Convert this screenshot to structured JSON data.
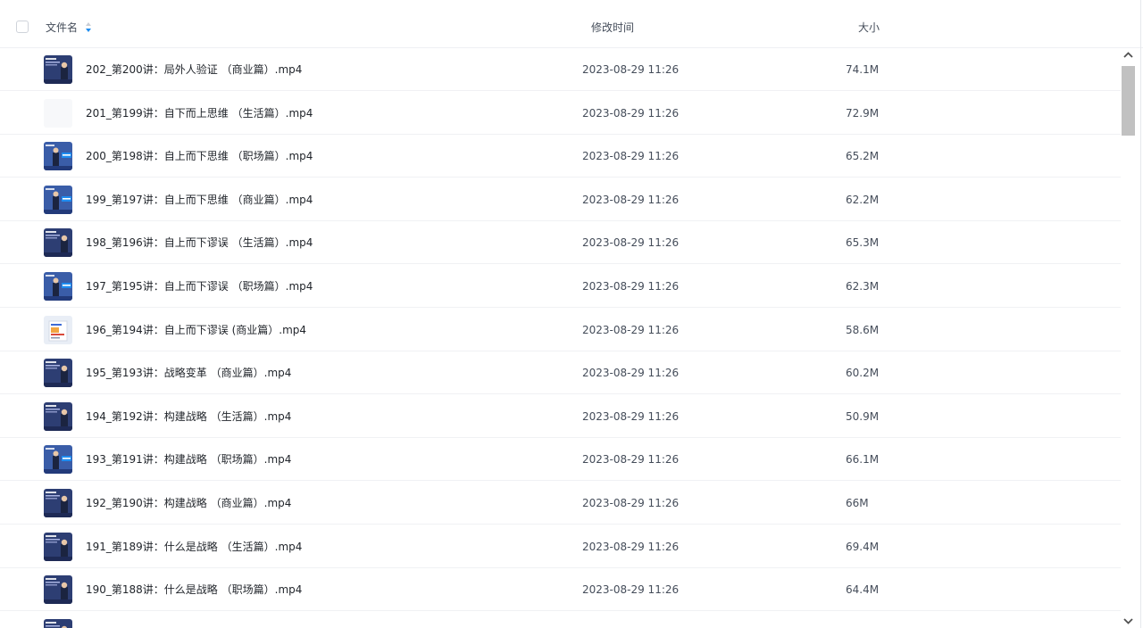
{
  "columns": {
    "name": "文件名",
    "modified": "修改时间",
    "size": "大小"
  },
  "files": [
    {
      "name": "202_第200讲：局外人验证 （商业篇）.mp4",
      "modified": "2023-08-29 11:26",
      "size": "74.1M",
      "thumb": "poster-dark"
    },
    {
      "name": "201_第199讲：自下而上思维 （生活篇）.mp4",
      "modified": "2023-08-29 11:26",
      "size": "72.9M",
      "thumb": "blank"
    },
    {
      "name": "200_第198讲：自上而下思维 （职场篇）.mp4",
      "modified": "2023-08-29 11:26",
      "size": "65.2M",
      "thumb": "poster-blue"
    },
    {
      "name": "199_第197讲：自上而下思维 （商业篇）.mp4",
      "modified": "2023-08-29 11:26",
      "size": "62.2M",
      "thumb": "poster-blue"
    },
    {
      "name": "198_第196讲：自上而下谬误 （生活篇）.mp4",
      "modified": "2023-08-29 11:26",
      "size": "65.3M",
      "thumb": "poster-dark"
    },
    {
      "name": "197_第195讲：自上而下谬误 （职场篇）.mp4",
      "modified": "2023-08-29 11:26",
      "size": "62.3M",
      "thumb": "poster-blue"
    },
    {
      "name": "196_第194讲：自上而下谬误 (商业篇）.mp4",
      "modified": "2023-08-29 11:26",
      "size": "58.6M",
      "thumb": "book"
    },
    {
      "name": "195_第193讲：战略变革 （商业篇）.mp4",
      "modified": "2023-08-29 11:26",
      "size": "60.2M",
      "thumb": "poster-dark"
    },
    {
      "name": "194_第192讲：构建战略 （生活篇）.mp4",
      "modified": "2023-08-29 11:26",
      "size": "50.9M",
      "thumb": "poster-dark"
    },
    {
      "name": "193_第191讲：构建战略 （职场篇）.mp4",
      "modified": "2023-08-29 11:26",
      "size": "66.1M",
      "thumb": "poster-blue"
    },
    {
      "name": "192_第190讲：构建战略 （商业篇）.mp4",
      "modified": "2023-08-29 11:26",
      "size": "66M",
      "thumb": "poster-dark"
    },
    {
      "name": "191_第189讲：什么是战略 （生活篇）.mp4",
      "modified": "2023-08-29 11:26",
      "size": "69.4M",
      "thumb": "poster-dark"
    },
    {
      "name": "190_第188讲：什么是战略 （职场篇）.mp4",
      "modified": "2023-08-29 11:26",
      "size": "64.4M",
      "thumb": "poster-dark"
    },
    {
      "name": "",
      "modified": "",
      "size": "",
      "thumb": "poster-dark"
    }
  ],
  "colors": {
    "accent": "#1e8cf0",
    "header_text": "#454d5a",
    "row_text": "#1f2329",
    "divider": "#f0f1f4",
    "scroll_thumb": "#c1c1c1"
  },
  "icons": {
    "sort": "sort-icon",
    "scroll_up": "chevron-up-icon",
    "scroll_down": "chevron-down-icon"
  }
}
